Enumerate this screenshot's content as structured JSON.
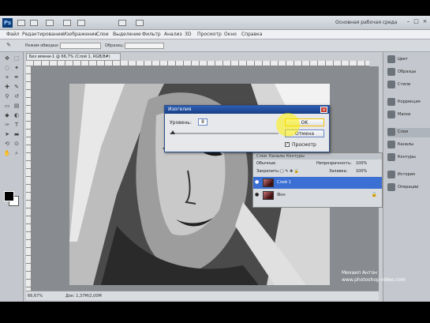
{
  "app": {
    "workspace": "Основная рабочая среда",
    "menu": [
      "Файл",
      "Редактирование",
      "Изображение",
      "Слои",
      "Выделение",
      "Фильтр",
      "Анализ",
      "3D",
      "Просмотр",
      "Окно",
      "Справка"
    ]
  },
  "options_bar": {
    "label1": "Режим обводки:",
    "label2": "Образец:"
  },
  "document": {
    "tab_title": "Без имени-1 @ 66,7% (Слой 1, RGB/8#)",
    "zoom": "66,67%",
    "doc_info": "Док: 1,37М/2,00М"
  },
  "dialog": {
    "title": "Изогелия",
    "level_label": "Уровень:",
    "level_value": "8",
    "ok_label": "OK",
    "cancel_label": "Отмена",
    "preview_label": "Просмотр",
    "preview_checked": true,
    "slider_fraction": 0.03
  },
  "layers": {
    "tabs": [
      "Слои",
      "Каналы",
      "Контуры"
    ],
    "blend_mode": "Обычные",
    "opacity_label": "Непрозрачность:",
    "opacity_value": "100%",
    "lock_label": "Закрепить:",
    "fill_label": "Заливка:",
    "fill_value": "100%",
    "items": [
      {
        "name": "Слой 1",
        "selected": true
      },
      {
        "name": "Фон",
        "selected": false
      }
    ]
  },
  "dock": [
    {
      "label": "Цвет",
      "icon": "color-icon"
    },
    {
      "label": "Образцы",
      "icon": "swatches-icon"
    },
    {
      "label": "Стили",
      "icon": "styles-icon"
    },
    {
      "label": "Коррекция",
      "icon": "adjustments-icon"
    },
    {
      "label": "Маски",
      "icon": "masks-icon"
    },
    {
      "label": "Слои",
      "icon": "layers-icon"
    },
    {
      "label": "Каналы",
      "icon": "channels-icon"
    },
    {
      "label": "Контуры",
      "icon": "paths-icon"
    },
    {
      "label": "История",
      "icon": "history-icon"
    },
    {
      "label": "Операции",
      "icon": "actions-icon"
    }
  ],
  "watermark": {
    "line1": "Михаил Антон",
    "line2": "www.photoshop-video.com"
  }
}
